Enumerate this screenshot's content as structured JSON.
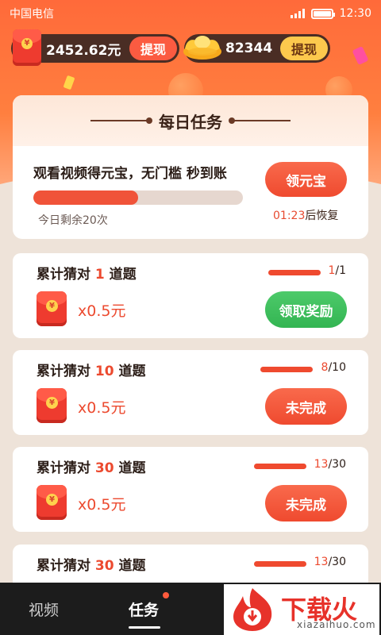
{
  "statusbar": {
    "carrier": "中国电信",
    "time": "12:30"
  },
  "wallet": {
    "cash_amount": "2452.62元",
    "cash_withdraw": "提现",
    "gold_amount": "82344",
    "gold_withdraw": "提现"
  },
  "daily": {
    "header": "每日任务",
    "task_title": "观看视频得元宝，无门槛 秒到账",
    "progress": 0.5,
    "remaining": "今日剩余20次",
    "button": "领元宝",
    "timer": "01:23",
    "timer_suffix": "后恢复"
  },
  "tasks": [
    {
      "prefix": "累计猜对 ",
      "num": "1",
      "suffix": " 道题",
      "done": "1",
      "total": "/1",
      "reward": "x0.5元",
      "button": "领取奖励",
      "state": "claim"
    },
    {
      "prefix": "累计猜对 ",
      "num": "10",
      "suffix": " 道题",
      "done": "8",
      "total": "/10",
      "reward": "x0.5元",
      "button": "未完成",
      "state": "incomplete"
    },
    {
      "prefix": "累计猜对 ",
      "num": "30",
      "suffix": " 道题",
      "done": "13",
      "total": "/30",
      "reward": "x0.5元",
      "button": "未完成",
      "state": "incomplete"
    },
    {
      "prefix": "累计猜对 ",
      "num": "30",
      "suffix": " 道题",
      "done": "13",
      "total": "/30"
    }
  ],
  "tabbar": {
    "video": "视频",
    "tasks": "任务"
  },
  "watermark": {
    "text": "下载火",
    "sub": "xiazaihuo.com"
  },
  "colors": {
    "accent": "#ef4a2f",
    "green": "#33b552",
    "gold": "#fdc94d",
    "dark": "#1c1c1c"
  }
}
